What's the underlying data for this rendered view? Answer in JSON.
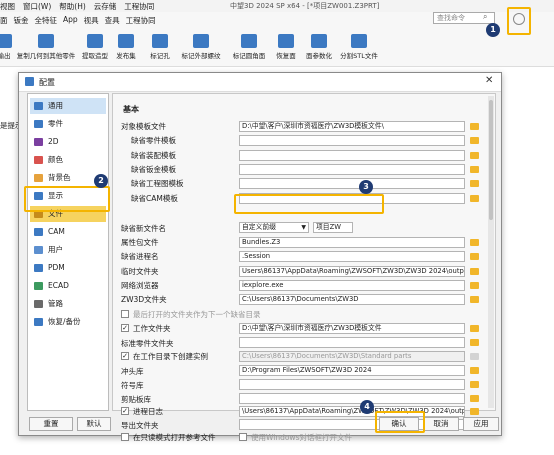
{
  "app": {
    "menus": [
      "视图",
      "窗口(W)",
      "帮助(H)",
      "云存储",
      "工程协同"
    ],
    "window_title": "中望3D 2024 SP x64 - [*项目ZW001.Z3PRT]",
    "ribbon_tabs": [
      "面",
      "钣金",
      "全特征",
      "App",
      "视具",
      "查具",
      "工程协同"
    ],
    "ribbon_buttons": [
      "输出",
      "复制几何到其他零件",
      "提取造型",
      "发布集",
      "标记孔",
      "标记外部螺纹",
      "标记圆角面",
      "恢复面",
      "面参数化",
      "分割STL文件"
    ],
    "search_placeholder": "查找命令",
    "left_text": "是提示."
  },
  "dialog": {
    "title": "配置",
    "close": "✕",
    "nav": [
      {
        "label": "通用",
        "color": "#3c79c2"
      },
      {
        "label": "零件",
        "color": "#3c79c2"
      },
      {
        "label": "2D",
        "color": "#7b3fa0"
      },
      {
        "label": "颜色",
        "color": "#d9534f"
      },
      {
        "label": "背景色",
        "color": "#e6a23c"
      },
      {
        "label": "显示",
        "color": "#3c79c2"
      },
      {
        "label": "文件",
        "color": "#c58b1a"
      },
      {
        "label": "CAM",
        "color": "#3c79c2"
      },
      {
        "label": "用户",
        "color": "#5c8fcf"
      },
      {
        "label": "PDM",
        "color": "#3c79c2"
      },
      {
        "label": "ECAD",
        "color": "#3c9a5f"
      },
      {
        "label": "管路",
        "color": "#6a6a6a"
      },
      {
        "label": "恢复/备份",
        "color": "#3c79c2"
      }
    ],
    "section_title": "基本",
    "rows": [
      {
        "label": "对象模板文件",
        "value": "D:\\中望\\客户\\深圳市资福医疗\\ZW3D模板文件\\"
      },
      {
        "label": "缺省零件模板",
        "value": ""
      },
      {
        "label": "缺省装配模板",
        "value": ""
      },
      {
        "label": "缺省钣金模板",
        "value": ""
      },
      {
        "label": "缺省工程图模板",
        "value": ""
      },
      {
        "label": "缺省CAM模板",
        "value": ""
      }
    ],
    "new_file_name_label": "缺省新文件名",
    "new_file_template_option": "自定义前缀",
    "new_file_name_value": "项目ZW",
    "rows2": [
      {
        "label": "属性包文件",
        "value": "Bundles.Z3"
      },
      {
        "label": "缺省进程名",
        "value": ".Session"
      },
      {
        "label": "临时文件夹",
        "value": "Users\\86137\\AppData\\Roaming\\ZWSOFT\\ZW3D\\ZW3D 2024\\output\\temp"
      },
      {
        "label": "网络浏览器",
        "value": "iexplore.exe"
      },
      {
        "label": "ZW3D文件夹",
        "value": "C:\\Users\\86137\\Documents\\ZW3D"
      }
    ],
    "last_opened_label": "最后打开的文件夹作为下一个缺省目录",
    "work_folder_label": "工作文件夹",
    "work_folder_value": "D:\\中望\\客户\\深圳市资福医疗\\ZW3D模板文件",
    "std_parts_label": "标准零件文件夹",
    "std_parts_value": "",
    "create_instance_label": "在工作目录下创建实例",
    "create_instance_value": "C:\\Users\\86137\\Documents\\ZW3D\\Standard parts",
    "punch_label": "冲头库",
    "punch_value": "D:\\Program Files\\ZWSOFT\\ZW3D 2024",
    "symbol_label": "符号库",
    "symbol_value": "",
    "clip_label": "剪贴板库",
    "clip_value": "",
    "log_label": "进程日志",
    "log_value": "\\Users\\86137\\AppData\\Roaming\\ZWSOFT\\ZW3D\\ZW3D 2024\\output\\logs",
    "export_label": "导出文件夹",
    "export_value": "",
    "readonly_label": "在只读模式打开参考文件",
    "windows_dialog_label": "使用Windows对话框打开文件",
    "buttons": {
      "reset": "重置",
      "default": "默认",
      "ok": "确认",
      "cancel": "取消",
      "apply": "应用"
    }
  },
  "badges": [
    "1",
    "2",
    "3",
    "4"
  ],
  "colors": {
    "highlight": "#f4b400",
    "badge": "#1f3b73",
    "folder": "#f1b62a"
  }
}
